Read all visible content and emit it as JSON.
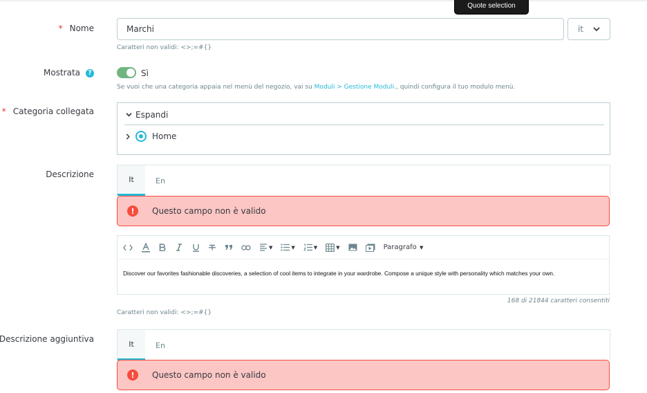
{
  "tooltip": "Quote selection",
  "name_field": {
    "label": "Nome",
    "required_mark": "*",
    "value": "Marchi",
    "language": "it",
    "hint": "Caratteri non validi: <>;=#{}"
  },
  "displayed": {
    "label": "Mostrata",
    "help_icon": "?",
    "toggle_state": "Sì",
    "hint_prefix": "Se vuoi che una categoria appaia nel menù del negozio, vai su ",
    "hint_link": "Moduli > Gestione Moduli",
    "hint_suffix": "., quindi configura il tuo modulo menù."
  },
  "category": {
    "label": "Categoria collegata",
    "required_mark": "*",
    "expand_label": "Espandi",
    "items": [
      {
        "label": "Home",
        "selected": true
      }
    ]
  },
  "description": {
    "label": "Descrizione",
    "tabs": [
      "It",
      "En"
    ],
    "error_icon": "!",
    "error": "Questo campo non è valido",
    "toolbar": {
      "paragraph": "Paragrafo"
    },
    "content": "Discover our favorites fashionable discoveries, a selection of cool items to integrate in your wardrobe. Compose a unique style with personality which matches your own.",
    "counter": "168 di 21844 caratteri consentiti",
    "hint": "Caratteri non validi: <>;=#{}"
  },
  "additional_description": {
    "label": "Descrizione aggiuntiva",
    "tabs": [
      "It",
      "En"
    ],
    "error_icon": "!",
    "error": "Questo campo non è valido"
  },
  "colors": {
    "accent": "#25b9d7",
    "error_bg": "#fbc6c3",
    "error_border": "#f54c3e",
    "toggle_on": "#70b580",
    "required": "#e5342d"
  }
}
